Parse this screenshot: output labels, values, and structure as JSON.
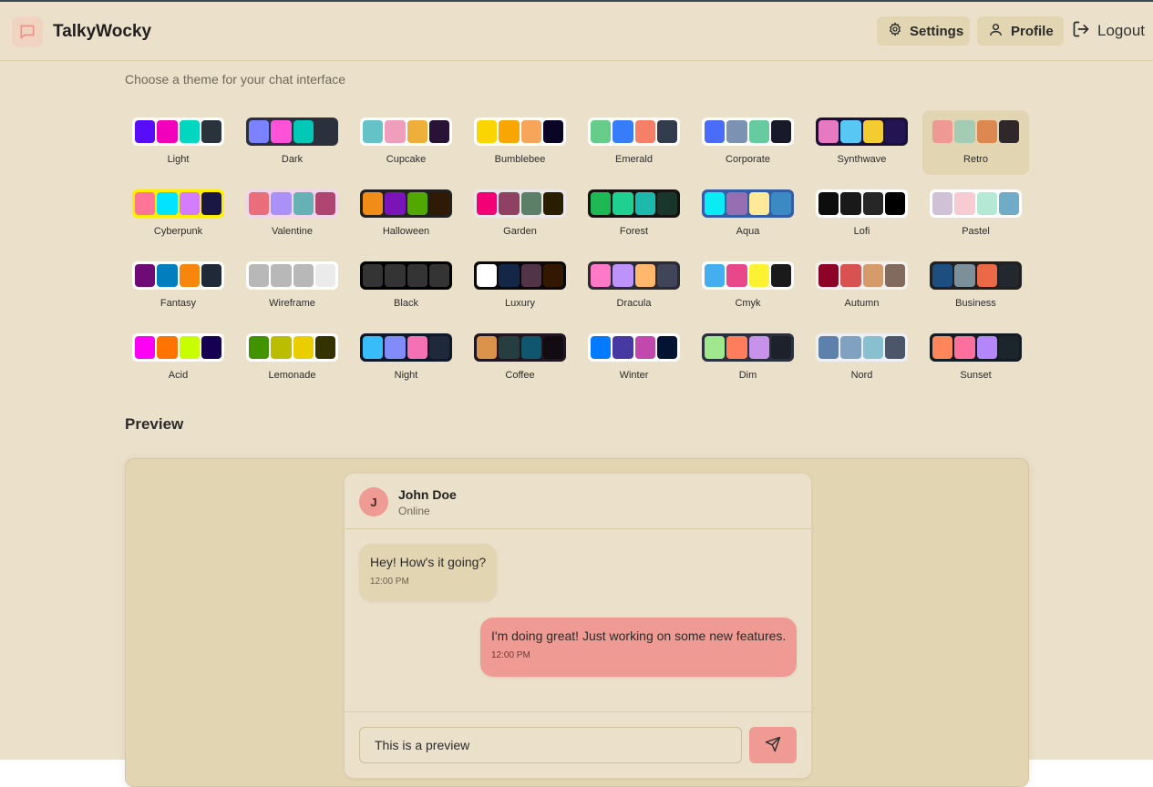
{
  "app": {
    "name": "TalkyWocky"
  },
  "nav": {
    "settings_label": "Settings",
    "profile_label": "Profile",
    "logout_label": "Logout"
  },
  "theme_section": {
    "subtitle": "Choose a theme for your chat interface",
    "selected": "Retro",
    "themes": [
      {
        "name": "Light",
        "frame": "#ffffff",
        "colors": [
          "#570df8",
          "#f000b8",
          "#00d7c0",
          "#2a323c"
        ]
      },
      {
        "name": "Dark",
        "frame": "#2a303c",
        "colors": [
          "#7b82fe",
          "#ff52d9",
          "#00c8b5",
          "#2a303c"
        ]
      },
      {
        "name": "Cupcake",
        "frame": "#ffffff",
        "colors": [
          "#65c3c8",
          "#ef9fbc",
          "#eeaf3a",
          "#291334"
        ]
      },
      {
        "name": "Bumblebee",
        "frame": "#ffffff",
        "colors": [
          "#fad500",
          "#f9a600",
          "#f7a55a",
          "#0a0525"
        ]
      },
      {
        "name": "Emerald",
        "frame": "#ffffff",
        "colors": [
          "#66cc8a",
          "#377cfb",
          "#f68067",
          "#333c4d"
        ]
      },
      {
        "name": "Corporate",
        "frame": "#ffffff",
        "colors": [
          "#4b6bfb",
          "#7b92b2",
          "#67cba0",
          "#181a2a"
        ]
      },
      {
        "name": "Synthwave",
        "frame": "#1a103d",
        "colors": [
          "#e779c1",
          "#58c7f3",
          "#f3cc30",
          "#221551"
        ]
      },
      {
        "name": "Retro",
        "frame": "#e1d5b2",
        "colors": [
          "#ef9995",
          "#a4cbb4",
          "#dc8850",
          "#2e282a"
        ]
      },
      {
        "name": "Cyberpunk",
        "frame": "#ffee00",
        "colors": [
          "#ff7598",
          "#00e5ff",
          "#d47cff",
          "#1a1744"
        ]
      },
      {
        "name": "Valentine",
        "frame": "#f0d6e8",
        "colors": [
          "#e96d7b",
          "#a991f7",
          "#66b1b3",
          "#af4670"
        ]
      },
      {
        "name": "Halloween",
        "frame": "#212121",
        "colors": [
          "#f28c18",
          "#7a13b8",
          "#51a800",
          "#2f1b05"
        ]
      },
      {
        "name": "Garden",
        "frame": "#e9e7e7",
        "colors": [
          "#f40076",
          "#8e4162",
          "#5c7f67",
          "#291e00"
        ]
      },
      {
        "name": "Forest",
        "frame": "#171212",
        "colors": [
          "#1eb854",
          "#1fd190",
          "#1db9ac",
          "#19362d"
        ]
      },
      {
        "name": "Aqua",
        "frame": "#345da7",
        "colors": [
          "#09ecf3",
          "#966fb3",
          "#ffe999",
          "#3b8ac4"
        ]
      },
      {
        "name": "Lofi",
        "frame": "#ffffff",
        "colors": [
          "#0d0d0d",
          "#1a1919",
          "#262626",
          "#000000"
        ]
      },
      {
        "name": "Pastel",
        "frame": "#ffffff",
        "colors": [
          "#d1c1d7",
          "#f6cbd1",
          "#b4e9d6",
          "#70acc7"
        ]
      },
      {
        "name": "Fantasy",
        "frame": "#ffffff",
        "colors": [
          "#6e0b75",
          "#007ebd",
          "#f8860d",
          "#1f2937"
        ]
      },
      {
        "name": "Wireframe",
        "frame": "#ffffff",
        "colors": [
          "#b8b8b8",
          "#b8b8b8",
          "#b8b8b8",
          "#ebebeb"
        ]
      },
      {
        "name": "Black",
        "frame": "#000000",
        "colors": [
          "#343434",
          "#343434",
          "#343434",
          "#343434"
        ]
      },
      {
        "name": "Luxury",
        "frame": "#09090b",
        "colors": [
          "#ffffff",
          "#152747",
          "#513448",
          "#331800"
        ]
      },
      {
        "name": "Dracula",
        "frame": "#282a36",
        "colors": [
          "#ff79c6",
          "#bd93f9",
          "#ffb86c",
          "#414558"
        ]
      },
      {
        "name": "Cmyk",
        "frame": "#ffffff",
        "colors": [
          "#45aeee",
          "#e8488a",
          "#fff232",
          "#1a1a1a"
        ]
      },
      {
        "name": "Autumn",
        "frame": "#f1f1f1",
        "colors": [
          "#8c0327",
          "#d85251",
          "#d59b6a",
          "#826a5c"
        ]
      },
      {
        "name": "Business",
        "frame": "#202020",
        "colors": [
          "#1c4e80",
          "#7c909a",
          "#ea6947",
          "#23282e"
        ]
      },
      {
        "name": "Acid",
        "frame": "#ffffff",
        "colors": [
          "#ff00f4",
          "#ff7400",
          "#c8ff00",
          "#140152"
        ]
      },
      {
        "name": "Lemonade",
        "frame": "#ffffff",
        "colors": [
          "#419400",
          "#bbbd00",
          "#eace00",
          "#343300"
        ]
      },
      {
        "name": "Night",
        "frame": "#0f172a",
        "colors": [
          "#38bdf8",
          "#818cf8",
          "#f471b5",
          "#1e293b"
        ]
      },
      {
        "name": "Coffee",
        "frame": "#20161f",
        "colors": [
          "#db924b",
          "#263e3f",
          "#10576d",
          "#120c12"
        ]
      },
      {
        "name": "Winter",
        "frame": "#ffffff",
        "colors": [
          "#047aff",
          "#463aa2",
          "#c148ac",
          "#021431"
        ]
      },
      {
        "name": "Dim",
        "frame": "#2a303c",
        "colors": [
          "#9fe88d",
          "#ff7d5c",
          "#c792e9",
          "#1c212b"
        ]
      },
      {
        "name": "Nord",
        "frame": "#eceff4",
        "colors": [
          "#5e81ac",
          "#81a1c1",
          "#88c0d0",
          "#4c566a"
        ]
      },
      {
        "name": "Sunset",
        "frame": "#121c22",
        "colors": [
          "#ff865b",
          "#fd6f9c",
          "#b387fa",
          "#1b262c"
        ]
      }
    ]
  },
  "preview": {
    "title": "Preview",
    "contact": {
      "initial": "J",
      "name": "John Doe",
      "status": "Online"
    },
    "messages": [
      {
        "text": "Hey! How's it going?",
        "time": "12:00 PM",
        "direction": "in"
      },
      {
        "text": "I'm doing great! Just working on some new features.",
        "time": "12:00 PM",
        "direction": "out"
      }
    ],
    "input_value": "This is a preview"
  },
  "colors": {
    "base": "#ebe1cb",
    "base_dark": "#e1d5b2",
    "primary": "#ef9a92"
  }
}
